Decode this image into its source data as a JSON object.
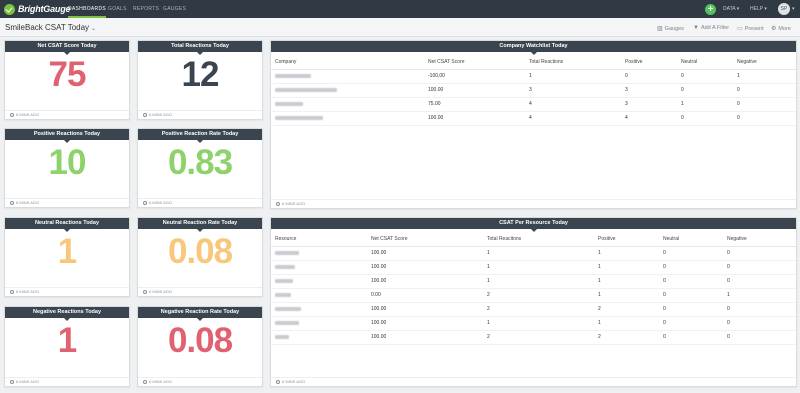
{
  "brand": {
    "logo_text": "BrightGauge",
    "accent": "#7cc242",
    "nav_bg": "#2f3a44"
  },
  "nav": {
    "links": [
      "DASHBOARDS",
      "GOALS",
      "REPORTS",
      "GAUGES"
    ],
    "active": "DASHBOARDS",
    "plus_label": "+",
    "data_label": "DATA",
    "help_label": "HELP",
    "avatar_initials": "SP"
  },
  "dashboard": {
    "title": "SmileBack CSAT Today",
    "toolbar": {
      "gauges": "Gauges",
      "add_filter": "Add A Filter",
      "present": "Present",
      "more": "More"
    }
  },
  "gauges": [
    {
      "title": "Net CSAT Score Today",
      "value": "75",
      "color": "#e06170",
      "updated": "6 MINS AGO"
    },
    {
      "title": "Total Reactions Today",
      "value": "12",
      "color": "#3a4550",
      "updated": "6 MINS AGO"
    },
    {
      "title": "Positive Reactions Today",
      "value": "10",
      "color": "#8fd16a",
      "updated": "6 MINS AGO"
    },
    {
      "title": "Positive Reaction Rate Today",
      "value": "0.83",
      "color": "#8fd16a",
      "updated": "6 MINS AGO"
    },
    {
      "title": "Neutral Reactions Today",
      "value": "1",
      "color": "#f8c77a",
      "updated": "6 MINS AGO"
    },
    {
      "title": "Neutral Reaction Rate Today",
      "value": "0.08",
      "color": "#f8c77a",
      "updated": "6 MINS AGO"
    },
    {
      "title": "Negative Reactions Today",
      "value": "1",
      "color": "#e06170",
      "updated": "6 MINS AGO"
    },
    {
      "title": "Negative Reaction Rate Today",
      "value": "0.08",
      "color": "#e06170",
      "updated": "6 MINS AGO"
    }
  ],
  "company_watchlist": {
    "title": "Company Watchlist Today",
    "columns": [
      "Company",
      "Net CSAT Score",
      "Total Reactions",
      "Positive",
      "Neutral",
      "Negative"
    ],
    "rows": [
      [
        "",
        "-100.00",
        "1",
        "0",
        "0",
        "1"
      ],
      [
        "",
        "100.00",
        "3",
        "3",
        "0",
        "0"
      ],
      [
        "",
        "75.00",
        "4",
        "3",
        "1",
        "0"
      ],
      [
        "",
        "100.00",
        "4",
        "4",
        "0",
        "0"
      ]
    ],
    "updated": "6 MINS AGO"
  },
  "csat_per_resource": {
    "title": "CSAT Per Resource Today",
    "columns": [
      "Resource",
      "Net CSAT Score",
      "Total Reacitons",
      "Positive",
      "Neutral",
      "Negative"
    ],
    "rows": [
      [
        "",
        "100.00",
        "1",
        "1",
        "0",
        "0"
      ],
      [
        "",
        "100.00",
        "1",
        "1",
        "0",
        "0"
      ],
      [
        "",
        "100.00",
        "1",
        "1",
        "0",
        "0"
      ],
      [
        "",
        "0.00",
        "2",
        "1",
        "0",
        "1"
      ],
      [
        "",
        "100.00",
        "2",
        "2",
        "0",
        "0"
      ],
      [
        "",
        "100.00",
        "1",
        "1",
        "0",
        "0"
      ],
      [
        "",
        "100.00",
        "2",
        "2",
        "0",
        "0"
      ]
    ],
    "updated": "6 MINS AGO"
  }
}
